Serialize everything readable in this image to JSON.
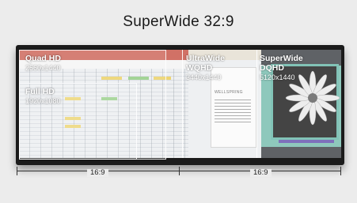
{
  "title": "SuperWide 32:9",
  "regions": [
    {
      "name": "Quad HD",
      "resolution": "2560x1440"
    },
    {
      "name": "Full HD",
      "resolution": "1920x1080"
    },
    {
      "name": "UltraWide WQHD",
      "name_line1": "UltraWide",
      "name_line2": "WQHD",
      "resolution": "3440x1440"
    },
    {
      "name": "SuperWide DQHD",
      "name_line1": "SuperWide",
      "name_line2": "DQHD",
      "resolution": "5120x1440"
    }
  ],
  "ratios": {
    "left": "16:9",
    "right": "16:9"
  },
  "document_label": "WELLSPRING",
  "colors": {
    "spreadsheet_ribbon": "#c44a3b",
    "slide_teal": "#6fb9aa",
    "slide_purple": "#5a4aa8"
  }
}
